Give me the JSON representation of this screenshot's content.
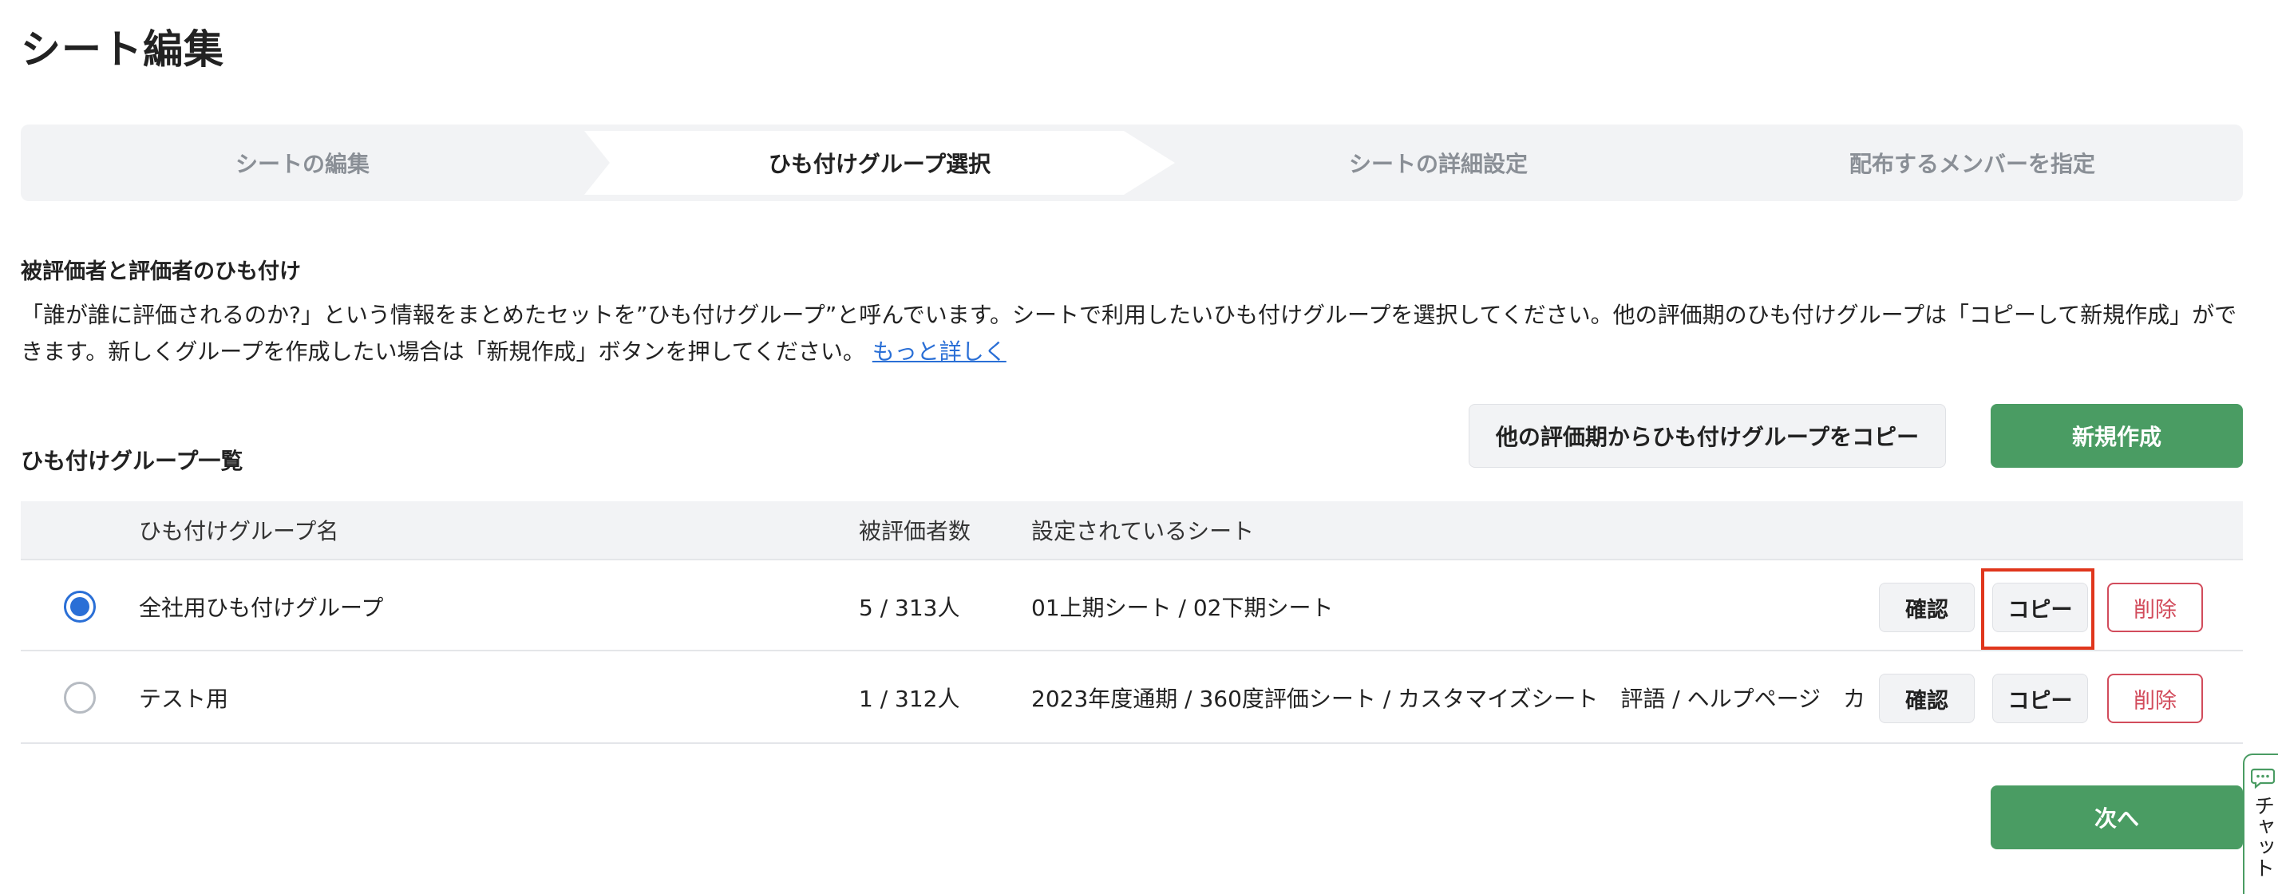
{
  "page": {
    "title": "シート編集"
  },
  "stepper": {
    "steps": [
      {
        "label": "シートの編集",
        "active": false
      },
      {
        "label": "ひも付けグループ選択",
        "active": true
      },
      {
        "label": "シートの詳細設定",
        "active": false
      },
      {
        "label": "配布するメンバーを指定",
        "active": false
      }
    ]
  },
  "section": {
    "heading": "被評価者と評価者のひも付け",
    "description": "「誰が誰に評価されるのか?」という情報をまとめたセットを”ひも付けグループ”と呼んでいます。シートで利用したいひも付けグループを選択してください。他の評価期のひも付けグループは「コピーして新規作成」ができます。新しくグループを作成したい場合は「新規作成」ボタンを押してください。",
    "more_link": "もっと詳しく"
  },
  "list": {
    "heading": "ひも付けグループ一覧",
    "copy_from_other_button": "他の評価期からひも付けグループをコピー",
    "new_button": "新規作成"
  },
  "table": {
    "columns": [
      "ひも付けグループ名",
      "被評価者数",
      "設定されているシート"
    ],
    "rows": [
      {
        "selected": true,
        "name": "全社用ひも付けグループ",
        "count": "5 / 313人",
        "sheets": "01上期シート / 02下期シート",
        "confirm": "確認",
        "copy": "コピー",
        "delete": "削除"
      },
      {
        "selected": false,
        "name": "テスト用",
        "count": "1 / 312人",
        "sheets": "2023年度通期 / 360度評価シート / カスタマイズシート　評語 / ヘルプページ　カ",
        "confirm": "確認",
        "copy": "コピー",
        "delete": "削除"
      }
    ]
  },
  "footer": {
    "next_button": "次へ"
  },
  "chat": {
    "label": "チャット",
    "icon": "chat-bubble-icon"
  },
  "colors": {
    "primary": "#4a9c63",
    "accent_blue": "#2a6fd6",
    "danger": "#d24c5c",
    "highlight": "#e0361c"
  }
}
